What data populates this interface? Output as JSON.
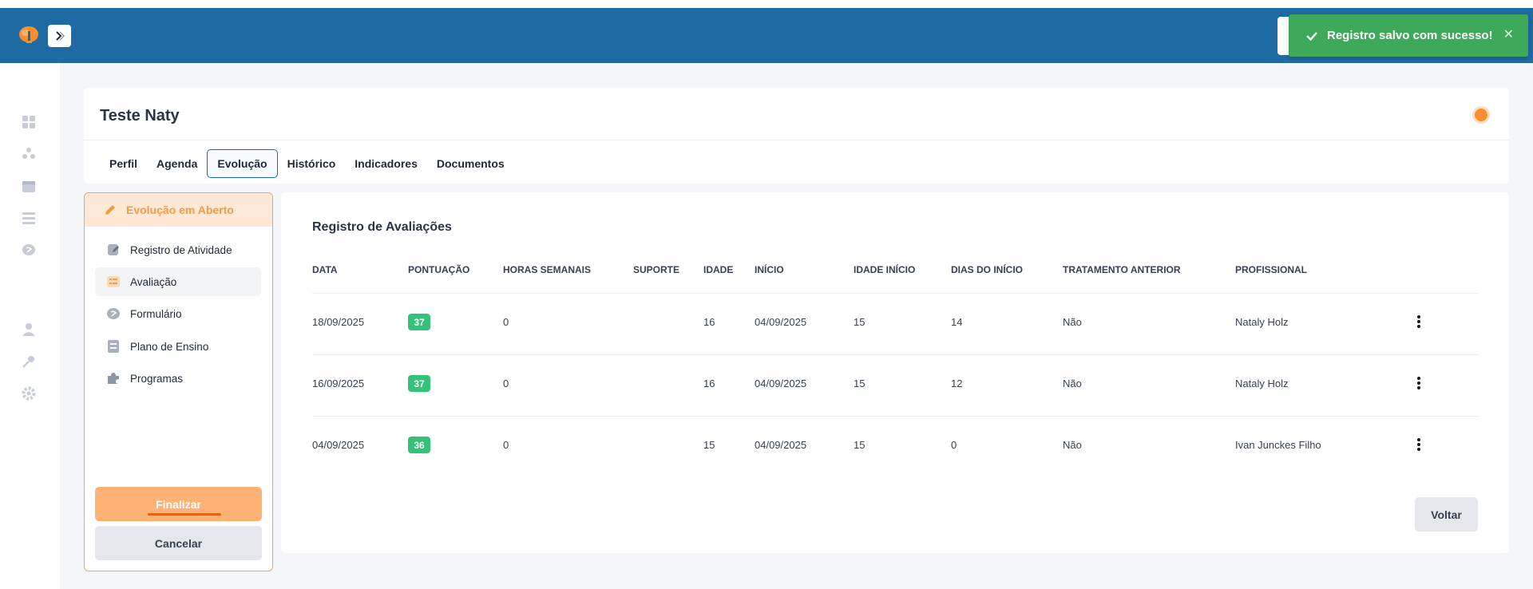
{
  "toast": {
    "message": "Registro salvo com sucesso!",
    "close": "✕"
  },
  "header": {
    "title": "Teste Naty"
  },
  "tabs": [
    {
      "label": "Perfil"
    },
    {
      "label": "Agenda"
    },
    {
      "label": "Evolução",
      "active": true
    },
    {
      "label": "Histórico"
    },
    {
      "label": "Indicadores"
    },
    {
      "label": "Documentos"
    }
  ],
  "left_panel": {
    "header": "Evolução em Aberto",
    "items": [
      {
        "label": "Registro de Atividade",
        "icon": "edit-doc-icon"
      },
      {
        "label": "Avaliação",
        "icon": "checklist-icon",
        "active": true
      },
      {
        "label": "Formulário",
        "icon": "form-icon"
      },
      {
        "label": "Plano de Ensino",
        "icon": "plan-icon"
      },
      {
        "label": "Programas",
        "icon": "puzzle-icon"
      }
    ],
    "finalizar": "Finalizar",
    "cancelar": "Cancelar"
  },
  "main": {
    "title": "Registro de Avaliações",
    "columns": [
      "DATA",
      "PONTUAÇÃO",
      "HORAS SEMANAIS",
      "SUPORTE",
      "IDADE",
      "INÍCIO",
      "IDADE INÍCIO",
      "DIAS DO INÍCIO",
      "TRATAMENTO ANTERIOR",
      "PROFISSIONAL"
    ],
    "rows": [
      {
        "data": "18/09/2025",
        "pontuacao": "37",
        "horas": "0",
        "suporte": "",
        "idade": "16",
        "inicio": "04/09/2025",
        "idade_inicio": "15",
        "dias": "14",
        "tratamento": "Não",
        "profissional": "Nataly Holz"
      },
      {
        "data": "16/09/2025",
        "pontuacao": "37",
        "horas": "0",
        "suporte": "",
        "idade": "16",
        "inicio": "04/09/2025",
        "idade_inicio": "15",
        "dias": "12",
        "tratamento": "Não",
        "profissional": "Nataly Holz"
      },
      {
        "data": "04/09/2025",
        "pontuacao": "36",
        "horas": "0",
        "suporte": "",
        "idade": "15",
        "inicio": "04/09/2025",
        "idade_inicio": "15",
        "dias": "0",
        "tratamento": "Não",
        "profissional": "Ivan Junckes Filho"
      }
    ],
    "voltar": "Voltar"
  },
  "colors": {
    "brand": "#1e6aa3",
    "accent": "#fb8f2f",
    "success": "#3ea85b",
    "score": "#34c27a"
  }
}
